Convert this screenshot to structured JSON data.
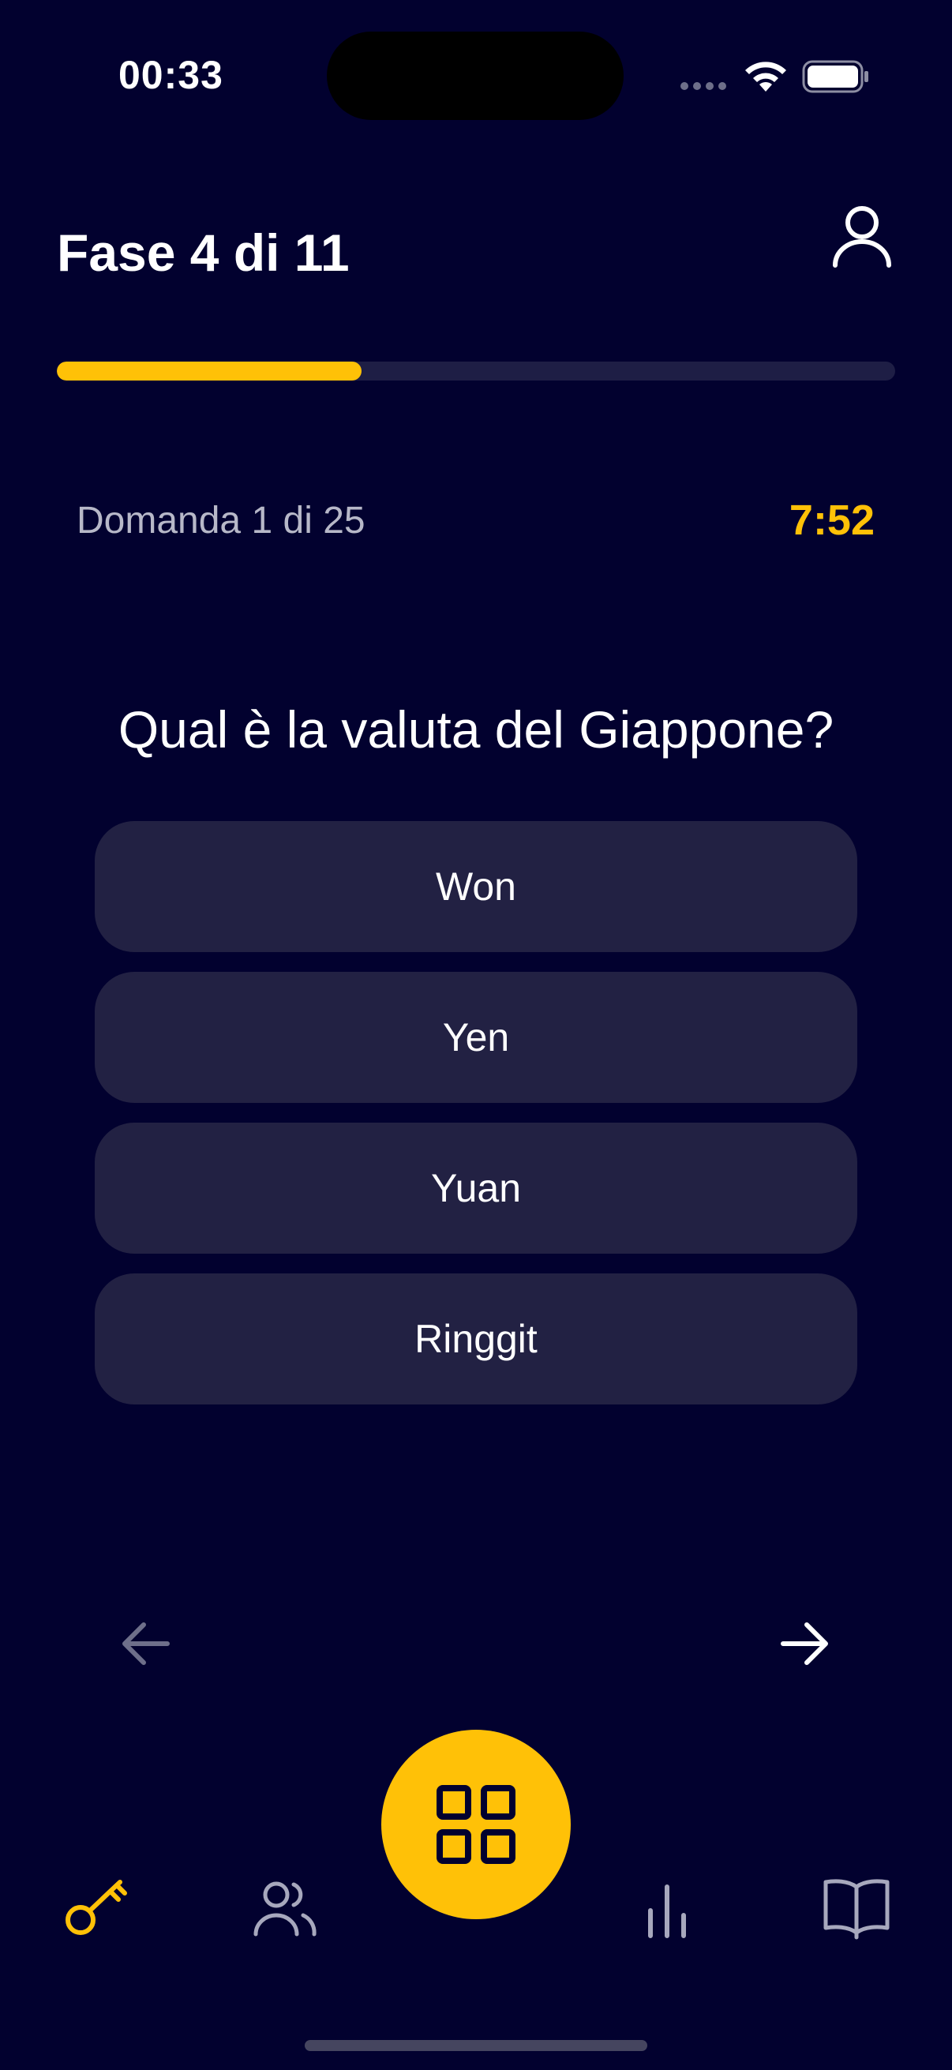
{
  "status_bar": {
    "time": "00:33"
  },
  "header": {
    "title": "Fase 4 di 11",
    "profile_icon": "person-icon"
  },
  "progress": {
    "fraction": 0.363,
    "fill_color": "#FFC107",
    "track_color": "#1E1E45"
  },
  "question": {
    "counter": "Domanda 1 di 25",
    "timer": "7:52",
    "text": "Qual è la valuta del Giappone?"
  },
  "answers": [
    {
      "label": "Won"
    },
    {
      "label": "Yen"
    },
    {
      "label": "Yuan"
    },
    {
      "label": "Ringgit"
    }
  ],
  "navigation": {
    "prev_icon": "arrow-left-icon",
    "next_icon": "arrow-right-icon"
  },
  "tab_bar": {
    "items": [
      {
        "icon": "key-icon",
        "active": true
      },
      {
        "icon": "people-icon",
        "active": false
      },
      {
        "icon": "grid-icon",
        "active": false
      },
      {
        "icon": "bar-chart-icon",
        "active": false
      },
      {
        "icon": "book-icon",
        "active": false
      }
    ]
  },
  "colors": {
    "background": "#02012F",
    "accent": "#FFC107",
    "answer_background": "#222143"
  }
}
